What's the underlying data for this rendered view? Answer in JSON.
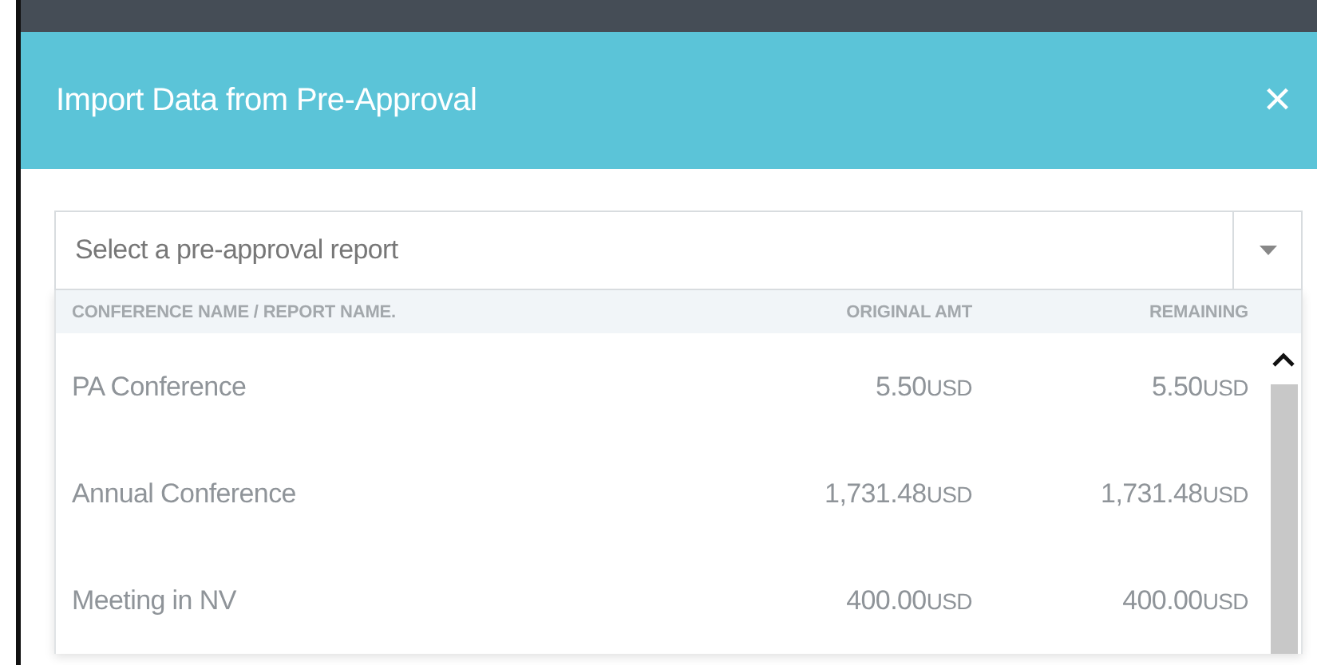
{
  "dialog": {
    "title": "Import Data from Pre-Approval",
    "close": "×"
  },
  "select": {
    "placeholder": "Select a pre-approval report"
  },
  "table": {
    "columns": [
      "CONFERENCE NAME / REPORT NAME.",
      "ORIGINAL AMT",
      "REMAINING"
    ],
    "rows": [
      {
        "name": "PA Conference",
        "original": "5.50",
        "original_currency": "USD",
        "remaining": "5.50",
        "remaining_currency": "USD"
      },
      {
        "name": "Annual Conference",
        "original": "1,731.48",
        "original_currency": "USD",
        "remaining": "1,731.48",
        "remaining_currency": "USD"
      },
      {
        "name": "Meeting in NV",
        "original": "400.00",
        "original_currency": "USD",
        "remaining": "400.00",
        "remaining_currency": "USD"
      }
    ]
  }
}
